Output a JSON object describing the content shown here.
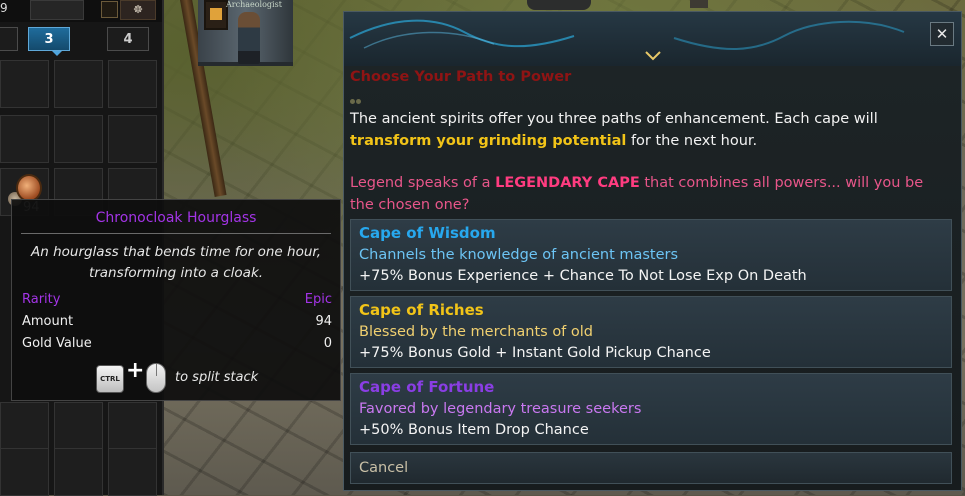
{
  "inventory": {
    "gold_amount": "9",
    "tabs": [
      {
        "label": "3"
      },
      {
        "label": "4"
      }
    ],
    "active_tab": "3",
    "item_stack_count": "94"
  },
  "world": {
    "npc_name": "Archaeologist"
  },
  "tooltip": {
    "item_name": "Chronocloak Hourglass",
    "description": "An hourglass that bends time for one hour, transforming into a cloak.",
    "rows": [
      {
        "key": "Rarity",
        "value": "Epic"
      },
      {
        "key": "Amount",
        "value": "94"
      },
      {
        "key": "Gold Value",
        "value": "0"
      }
    ],
    "ctrl_key_label": "CTRL",
    "plus_sign": "+",
    "split_hint": "to split stack",
    "colors": {
      "epic": "#a334e6",
      "text": "#f0f0f0"
    }
  },
  "dialog": {
    "close_label": "✕",
    "title": "Choose Your Path to Power",
    "intro_before": "The ancient spirits offer you three paths of enhancement. Each cape will ",
    "intro_highlight": "transform your grinding potential",
    "intro_after": " for the next hour.",
    "legend_before": "Legend speaks of a ",
    "legend_highlight": "LEGENDARY CAPE",
    "legend_after": " that combines all powers... will you be the chosen one?",
    "options": [
      {
        "name": "Cape of Wisdom",
        "description": "Channels the knowledge of ancient masters",
        "bonus": "+75% Bonus Experience + Chance To Not Lose Exp On Death",
        "name_color": "#27a8ee",
        "desc_color": "#6cc4f4"
      },
      {
        "name": "Cape of Riches",
        "description": "Blessed by the merchants of old",
        "bonus": "+75% Bonus Gold + Instant Gold Pickup Chance",
        "name_color": "#f2c418",
        "desc_color": "#f0d070"
      },
      {
        "name": "Cape of Fortune",
        "description": "Favored by legendary treasure seekers",
        "bonus": "+50% Bonus Item Drop Chance",
        "name_color": "#8a3ee4",
        "desc_color": "#c978f0"
      }
    ],
    "cancel_label": "Cancel",
    "colors": {
      "title": "#8f1414",
      "highlight_gold": "#f2c418",
      "legend_pink": "#e8568a"
    }
  }
}
